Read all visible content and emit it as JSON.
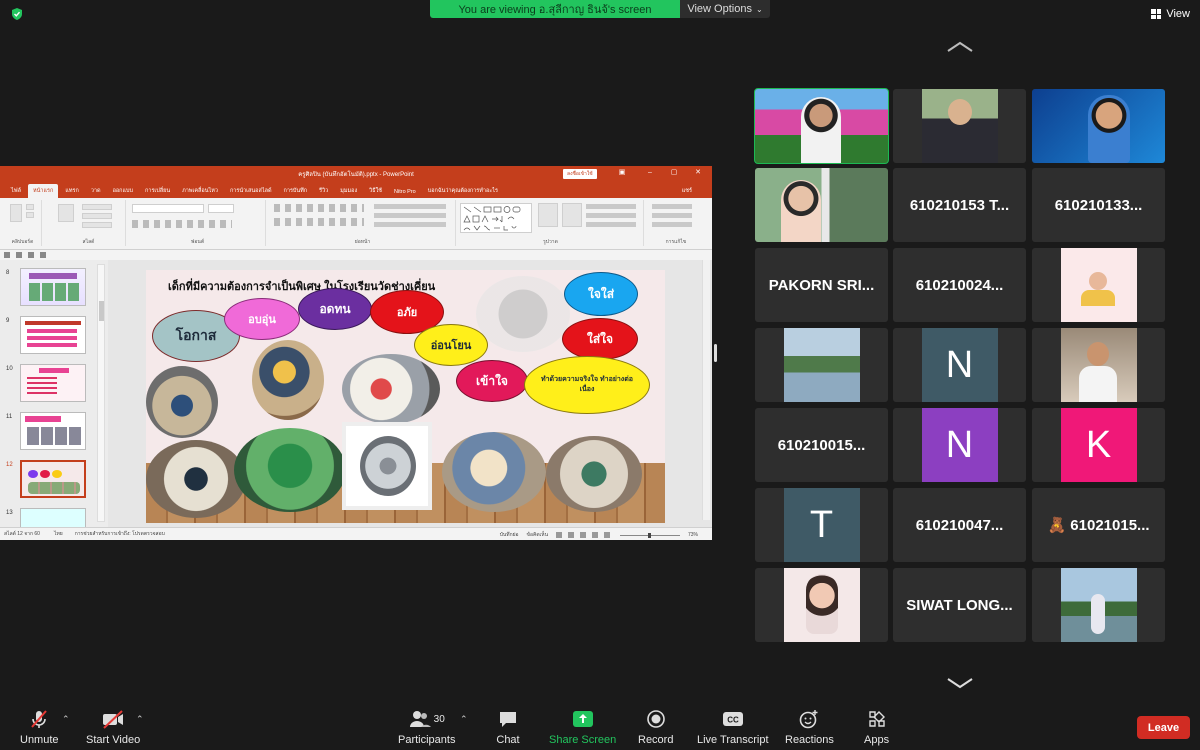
{
  "top": {
    "banner": "You are viewing อ.สุลีกาญ ธินจ้'s screen",
    "view_options": "View Options",
    "view": "View"
  },
  "ppt": {
    "title": "ครูศิลปิน (บันทึกอัตโนมัติ).pptx  -  PowerPoint",
    "signin": "ลงชื่อเข้าใช้",
    "tabs": [
      "ไฟล์",
      "หน้าแรก",
      "แทรก",
      "วาด",
      "ออกแบบ",
      "การเปลี่ยน",
      "ภาพเคลื่อนไหว",
      "การนำเสนอสไลด์",
      "การบันทึก",
      "รีวิว",
      "มุมมอง",
      "วิธีใช้",
      "Nitro Pro",
      "บอกฉันว่าคุณต้องการทำอะไร",
      "แชร์"
    ],
    "groups": [
      "คลิปบอร์ด",
      "สไลด์",
      "ฟอนต์",
      "ย่อหน้า",
      "รูปวาด",
      "การแก้ไข"
    ],
    "thumb_numbers": [
      "8",
      "9",
      "10",
      "11",
      "12",
      "13"
    ],
    "status_left": "สไลด์ 12 จาก 60",
    "status_lang": "ไทย",
    "status_access": "การช่วยสำหรับการเข้าถึง: โปรดตรวจสอบ",
    "status_notes": "บันทึกย่อ",
    "status_comments": "ข้อคิดเห็น",
    "zoom": "73%"
  },
  "slide": {
    "title": "เด็กที่มีความต้องการจำเป็นพิเศษ ในโรงเรียนวัดช่างเคี่ยน",
    "bubbles": [
      "โอกาส",
      "อบอุ่น",
      "อดทน",
      "อภัย",
      "อ่อนโยน",
      "เข้าใจ",
      "ใจใส่",
      "ใส่ใจ",
      "ทำด้วยความจริงใจ ทำอย่างต่อเนื่อง"
    ]
  },
  "gallery": {
    "tiles": [
      {
        "kind": "video",
        "label": ""
      },
      {
        "kind": "video",
        "label": ""
      },
      {
        "kind": "video",
        "label": ""
      },
      {
        "kind": "video",
        "label": ""
      },
      {
        "kind": "name",
        "label": "610210153 T..."
      },
      {
        "kind": "name",
        "label": "610210133..."
      },
      {
        "kind": "name",
        "label": "PAKORN SRI..."
      },
      {
        "kind": "name",
        "label": "610210024..."
      },
      {
        "kind": "picture",
        "label": ""
      },
      {
        "kind": "picture",
        "label": ""
      },
      {
        "kind": "avatar",
        "label": "N",
        "color": "#3f5a66"
      },
      {
        "kind": "picture",
        "label": ""
      },
      {
        "kind": "name",
        "label": "610210015..."
      },
      {
        "kind": "avatar",
        "label": "N",
        "color": "#8c3fc1"
      },
      {
        "kind": "avatar",
        "label": "K",
        "color": "#f01878"
      },
      {
        "kind": "avatar",
        "label": "T",
        "color": "#3f5a66"
      },
      {
        "kind": "name",
        "label": "610210047..."
      },
      {
        "kind": "name",
        "label": "🧸 61021015..."
      },
      {
        "kind": "picture",
        "label": ""
      },
      {
        "kind": "name",
        "label": "SIWAT LONG..."
      },
      {
        "kind": "picture",
        "label": ""
      }
    ]
  },
  "toolbar": {
    "unmute": "Unmute",
    "start_video": "Start Video",
    "participants": "Participants",
    "participants_count": "30",
    "chat": "Chat",
    "share_screen": "Share Screen",
    "record": "Record",
    "live_transcript": "Live Transcript",
    "reactions": "Reactions",
    "apps": "Apps",
    "leave": "Leave"
  },
  "colors": {
    "accent_green": "#22c55e",
    "ppt_red": "#c43e1c",
    "leave_red": "#d12c23"
  }
}
